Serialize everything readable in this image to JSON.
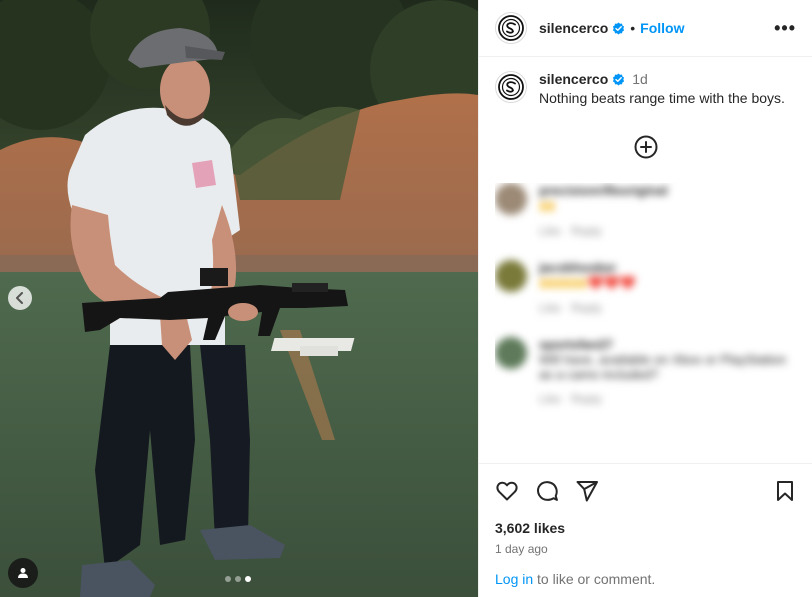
{
  "post": {
    "author": "silencerco",
    "follow_label": "Follow",
    "separator": "•",
    "more_label": "•••",
    "caption_author": "silencerco",
    "caption_time": "1d",
    "caption_text": "Nothing beats range time with the boys.",
    "likes": "3,602 likes",
    "posted": "1 day ago"
  },
  "comments": [
    {
      "user": "precisionrifleoriginal",
      "text": "🙌",
      "meta_like": "Like",
      "meta_reply": "Reply",
      "avatar_color": "#9c8a76"
    },
    {
      "user": "jacobhooker",
      "text": "🙌🙌🙌❤️❤️❤️",
      "meta_like": "Like",
      "meta_reply": "Reply",
      "avatar_color": "#7a7a3a"
    },
    {
      "user": "sportsfan27",
      "text": "Will have, available on Xbox or PlayStation as a camo included?",
      "meta_like": "Like",
      "meta_reply": "Reply",
      "avatar_color": "#5e7a5a"
    }
  ],
  "footer": {
    "login_link": "Log in",
    "login_rest": " to like or comment."
  },
  "carousel": {
    "dots": 3,
    "active_index": 2
  },
  "colors": {
    "accent": "#0095f6",
    "verified": "#0095f6",
    "text": "#262626",
    "muted": "#737373"
  },
  "icons": {
    "like": "heart-icon",
    "comment": "comment-icon",
    "share": "share-icon",
    "save": "bookmark-icon",
    "add": "plus-circle-icon",
    "prev": "chevron-left-icon",
    "tags": "user-tag-icon"
  }
}
